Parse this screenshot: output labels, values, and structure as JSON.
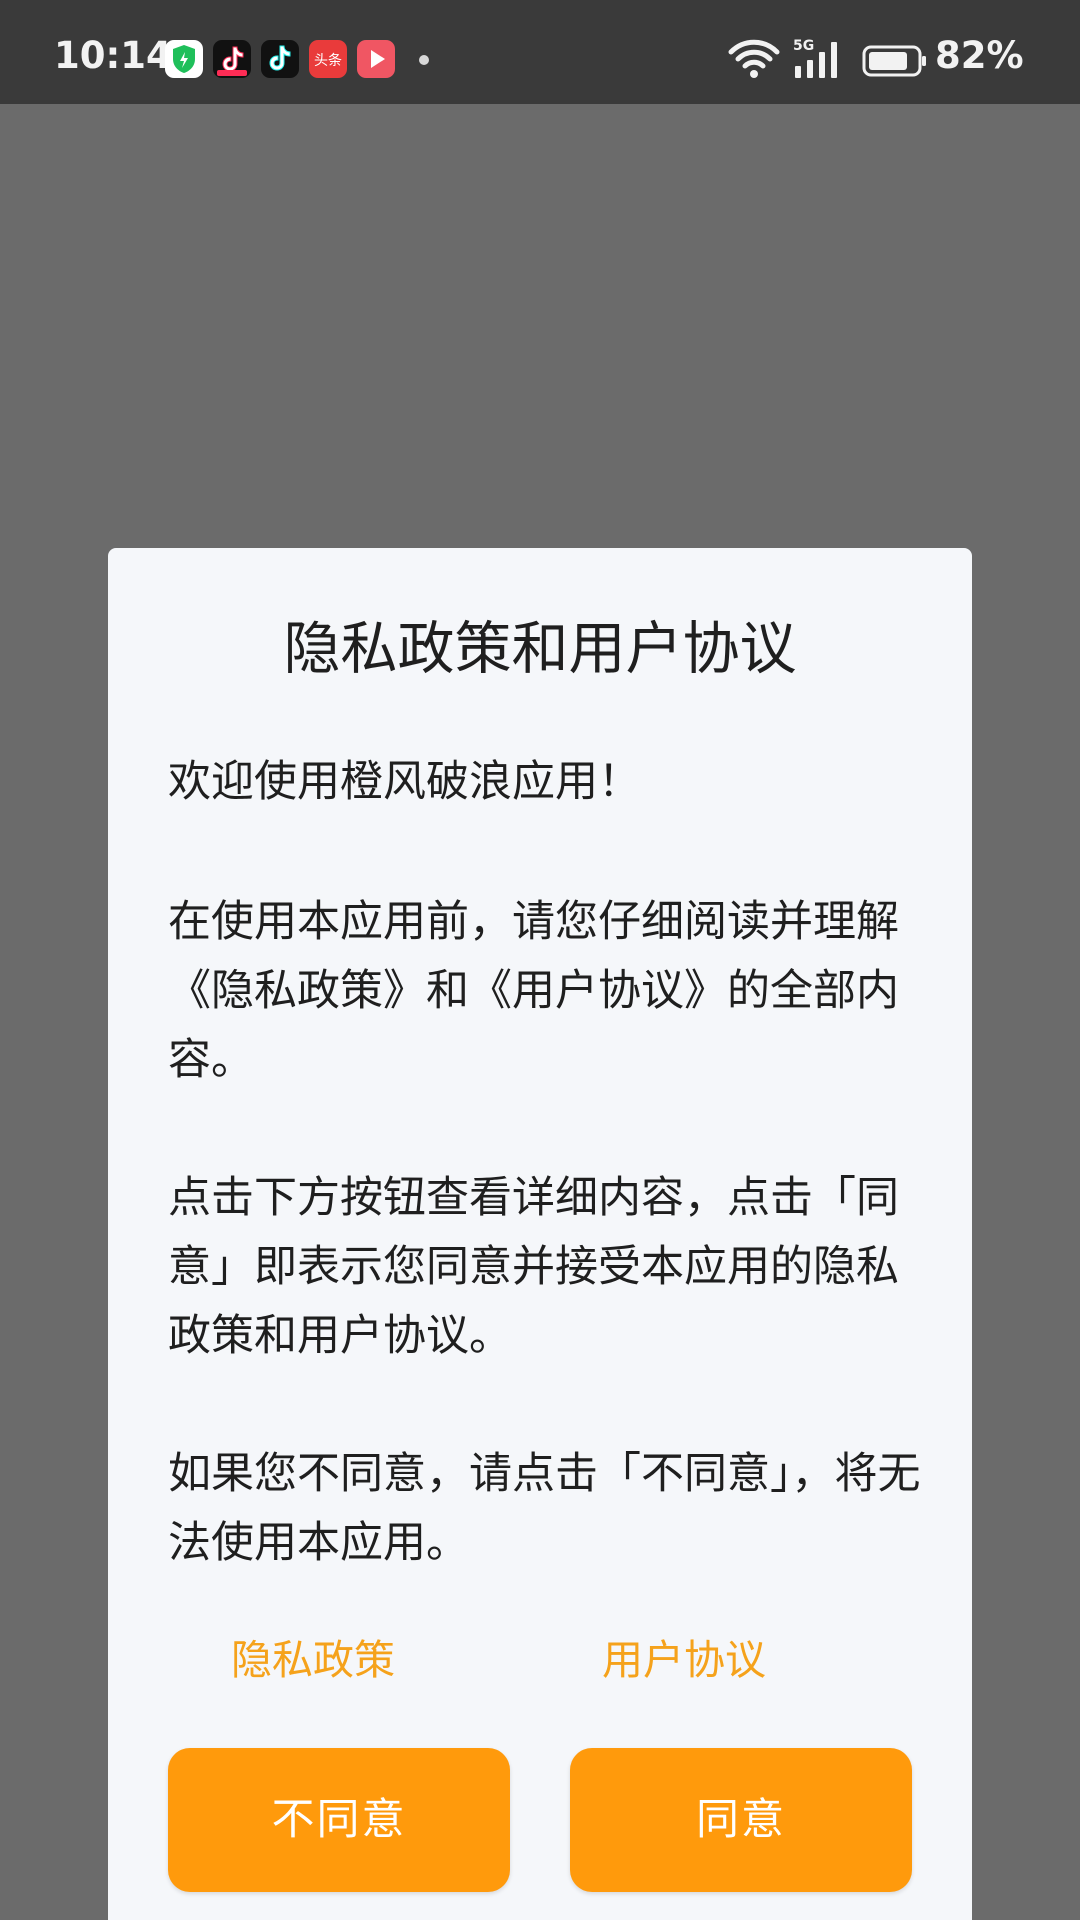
{
  "status_bar": {
    "time": "10:14",
    "battery_percent": "82%",
    "network_type": "5G",
    "battery_level": 0.82,
    "notification_icons": [
      "security-icon",
      "douyin-lite-icon",
      "douyin-icon",
      "toutiao-icon",
      "video-player-icon"
    ],
    "toutiao_label": "头条"
  },
  "dialog": {
    "title": "隐私政策和用户协议",
    "welcome": "欢迎使用橙风破浪应用！",
    "intro": "在使用本应用前，请您仔细阅读并理解《隐私政策》和《用户协议》的全部内容。",
    "instruction": "点击下方按钮查看详细内容，点击「同意」即表示您同意并接受本应用的隐私政策和用户协议。",
    "disagree_note": "如果您不同意，请点击「不同意」，将无法使用本应用。",
    "privacy_link": "隐私政策",
    "terms_link": "用户协议",
    "disagree_button": "不同意",
    "agree_button": "同意"
  },
  "colors": {
    "accent": "#ff9a0c",
    "link": "#f5a21b",
    "overlay": "#6b6b6b",
    "status_bar": "#3a3a3a",
    "dialog_bg": "#f5f7fa"
  }
}
